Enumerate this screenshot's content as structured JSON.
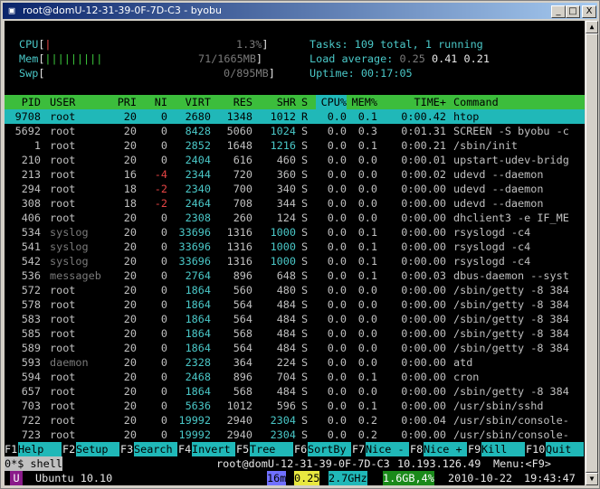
{
  "window": {
    "title": "root@domU-12-31-39-0F-7D-C3 - byobu",
    "min_label": "_",
    "max_label": "□",
    "close_label": "X"
  },
  "meters": {
    "cpu_label": "CPU",
    "cpu_bar": "|",
    "cpu_value": "1.3%",
    "mem_label": "Mem",
    "mem_bar": "|||||||||",
    "mem_value": "71/1665MB",
    "swp_label": "Swp",
    "swp_value": "0/895MB",
    "open_bracket": "[",
    "close_bracket": "]"
  },
  "summary": {
    "tasks_label": "Tasks:",
    "tasks_text": "109 total, 1 running",
    "load_label": "Load average:",
    "load_1": "0.25",
    "load_5": "0.41",
    "load_15": "0.21",
    "uptime_label": "Uptime:",
    "uptime_value": "00:17:05"
  },
  "columns": [
    "PID",
    "USER",
    "PRI",
    "NI",
    "VIRT",
    "RES",
    "SHR",
    "S",
    "CPU%",
    "MEM%",
    "TIME+",
    "Command"
  ],
  "processes": [
    [
      "9708",
      "root",
      "20",
      "0",
      "2680",
      "1348",
      "1012",
      "R",
      "0.0",
      "0.1",
      "0:00.42",
      "htop"
    ],
    [
      "5692",
      "root",
      "20",
      "0",
      "8428",
      "5060",
      "1024",
      "S",
      "0.0",
      "0.3",
      "0:01.31",
      "SCREEN -S byobu -c"
    ],
    [
      "1",
      "root",
      "20",
      "0",
      "2852",
      "1648",
      "1216",
      "S",
      "0.0",
      "0.1",
      "0:00.21",
      "/sbin/init"
    ],
    [
      "210",
      "root",
      "20",
      "0",
      "2404",
      "616",
      "460",
      "S",
      "0.0",
      "0.0",
      "0:00.01",
      "upstart-udev-bridg"
    ],
    [
      "213",
      "root",
      "16",
      "-4",
      "2344",
      "720",
      "360",
      "S",
      "0.0",
      "0.0",
      "0:00.02",
      "udevd --daemon"
    ],
    [
      "294",
      "root",
      "18",
      "-2",
      "2340",
      "700",
      "340",
      "S",
      "0.0",
      "0.0",
      "0:00.00",
      "udevd --daemon"
    ],
    [
      "308",
      "root",
      "18",
      "-2",
      "2464",
      "708",
      "344",
      "S",
      "0.0",
      "0.0",
      "0:00.00",
      "udevd --daemon"
    ],
    [
      "406",
      "root",
      "20",
      "0",
      "2308",
      "260",
      "124",
      "S",
      "0.0",
      "0.0",
      "0:00.00",
      "dhclient3 -e IF_ME"
    ],
    [
      "534",
      "syslog",
      "20",
      "0",
      "33696",
      "1316",
      "1000",
      "S",
      "0.0",
      "0.1",
      "0:00.00",
      "rsyslogd -c4"
    ],
    [
      "541",
      "syslog",
      "20",
      "0",
      "33696",
      "1316",
      "1000",
      "S",
      "0.0",
      "0.1",
      "0:00.00",
      "rsyslogd -c4"
    ],
    [
      "542",
      "syslog",
      "20",
      "0",
      "33696",
      "1316",
      "1000",
      "S",
      "0.0",
      "0.1",
      "0:00.00",
      "rsyslogd -c4"
    ],
    [
      "536",
      "messageb",
      "20",
      "0",
      "2764",
      "896",
      "648",
      "S",
      "0.0",
      "0.1",
      "0:00.03",
      "dbus-daemon --syst"
    ],
    [
      "572",
      "root",
      "20",
      "0",
      "1864",
      "560",
      "480",
      "S",
      "0.0",
      "0.0",
      "0:00.00",
      "/sbin/getty -8 384"
    ],
    [
      "578",
      "root",
      "20",
      "0",
      "1864",
      "564",
      "484",
      "S",
      "0.0",
      "0.0",
      "0:00.00",
      "/sbin/getty -8 384"
    ],
    [
      "583",
      "root",
      "20",
      "0",
      "1864",
      "564",
      "484",
      "S",
      "0.0",
      "0.0",
      "0:00.00",
      "/sbin/getty -8 384"
    ],
    [
      "585",
      "root",
      "20",
      "0",
      "1864",
      "568",
      "484",
      "S",
      "0.0",
      "0.0",
      "0:00.00",
      "/sbin/getty -8 384"
    ],
    [
      "589",
      "root",
      "20",
      "0",
      "1864",
      "564",
      "484",
      "S",
      "0.0",
      "0.0",
      "0:00.00",
      "/sbin/getty -8 384"
    ],
    [
      "593",
      "daemon",
      "20",
      "0",
      "2328",
      "364",
      "224",
      "S",
      "0.0",
      "0.0",
      "0:00.00",
      "atd"
    ],
    [
      "594",
      "root",
      "20",
      "0",
      "2468",
      "896",
      "704",
      "S",
      "0.0",
      "0.1",
      "0:00.00",
      "cron"
    ],
    [
      "657",
      "root",
      "20",
      "0",
      "1864",
      "568",
      "484",
      "S",
      "0.0",
      "0.0",
      "0:00.00",
      "/sbin/getty -8 384"
    ],
    [
      "703",
      "root",
      "20",
      "0",
      "5636",
      "1012",
      "596",
      "S",
      "0.0",
      "0.1",
      "0:00.00",
      "/usr/sbin/sshd"
    ],
    [
      "722",
      "root",
      "20",
      "0",
      "19992",
      "2940",
      "2304",
      "S",
      "0.0",
      "0.2",
      "0:00.04",
      "/usr/sbin/console-"
    ],
    [
      "723",
      "root",
      "20",
      "0",
      "19992",
      "2940",
      "2304",
      "S",
      "0.0",
      "0.2",
      "0:00.00",
      "/usr/sbin/console-"
    ]
  ],
  "fkeys": [
    {
      "key": "F1",
      "label": "Help  "
    },
    {
      "key": "F2",
      "label": "Setup "
    },
    {
      "key": "F3",
      "label": "Search"
    },
    {
      "key": "F4",
      "label": "Invert"
    },
    {
      "key": "F5",
      "label": "Tree  "
    },
    {
      "key": "F6",
      "label": "SortBy"
    },
    {
      "key": "F7",
      "label": "Nice -"
    },
    {
      "key": "F8",
      "label": "Nice +"
    },
    {
      "key": "F9",
      "label": "Kill  "
    },
    {
      "key": "F10",
      "label": "Quit"
    }
  ],
  "shell_bar": {
    "tab_label": "0*$ shell",
    "host": "root@domU-12-31-39-0F-7D-C3",
    "ip": "10.193.126.49",
    "menu": "Menu:<F9>"
  },
  "status_bar": {
    "logo": "U",
    "os": "Ubuntu 10.10",
    "procs": "16m",
    "load": "0.25",
    "freq": "2.7GHz",
    "mem": "1.6GB,4%",
    "date": "2010-10-22",
    "time": "19:43:47"
  },
  "colors": {
    "accent_cyan": "#20b8b8",
    "header_green": "#3cbd3c",
    "negative_red": "#e84545"
  }
}
